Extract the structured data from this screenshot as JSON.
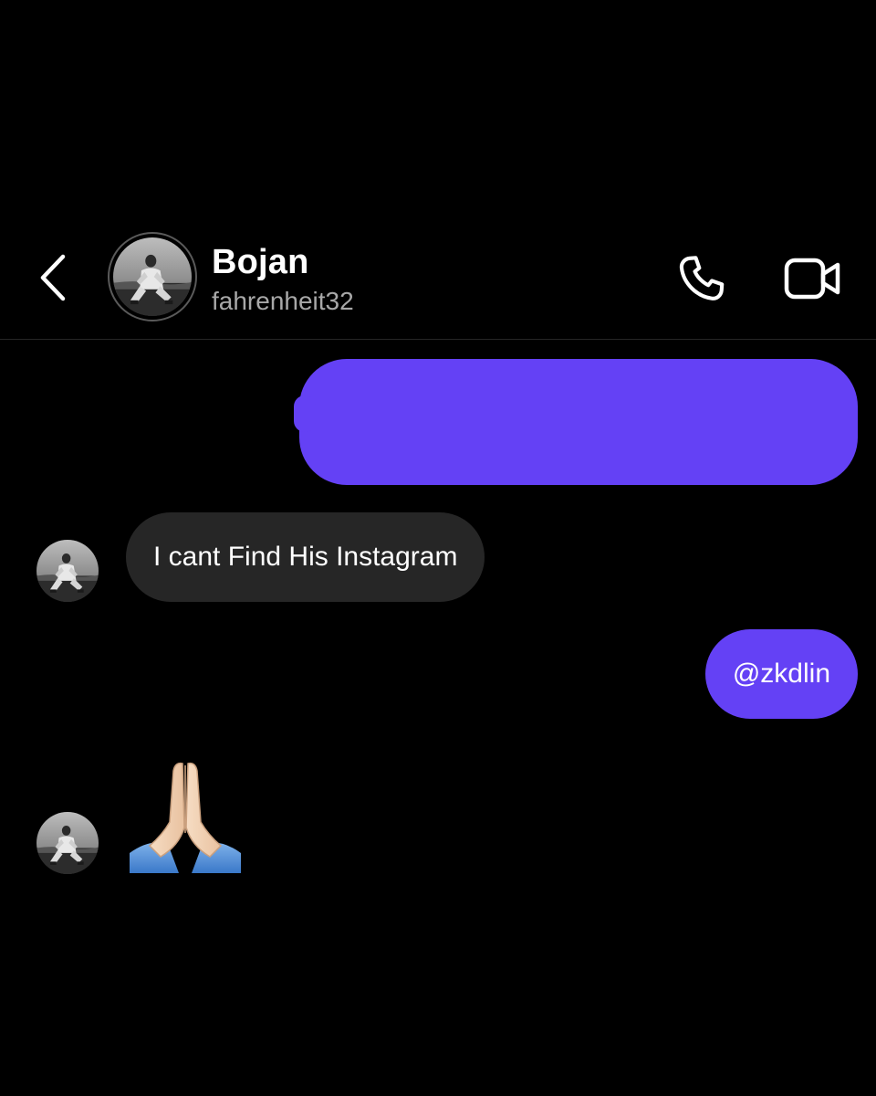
{
  "header": {
    "name": "Bojan",
    "username": "fahrenheit32",
    "back_icon": "chevron-left-icon",
    "call_icon": "phone-icon",
    "video_icon": "video-camera-icon"
  },
  "messages": [
    {
      "direction": "outgoing",
      "text": "",
      "redacted": true
    },
    {
      "direction": "incoming",
      "text": "I cant Find His Instagram"
    },
    {
      "direction": "outgoing",
      "text": "@zkdlin"
    },
    {
      "direction": "incoming",
      "emoji": "folded-hands-icon"
    }
  ],
  "colors": {
    "background": "#000000",
    "outgoing_bubble": "#6441f5",
    "incoming_bubble": "#262626",
    "secondary_text": "#a8a8a8"
  }
}
